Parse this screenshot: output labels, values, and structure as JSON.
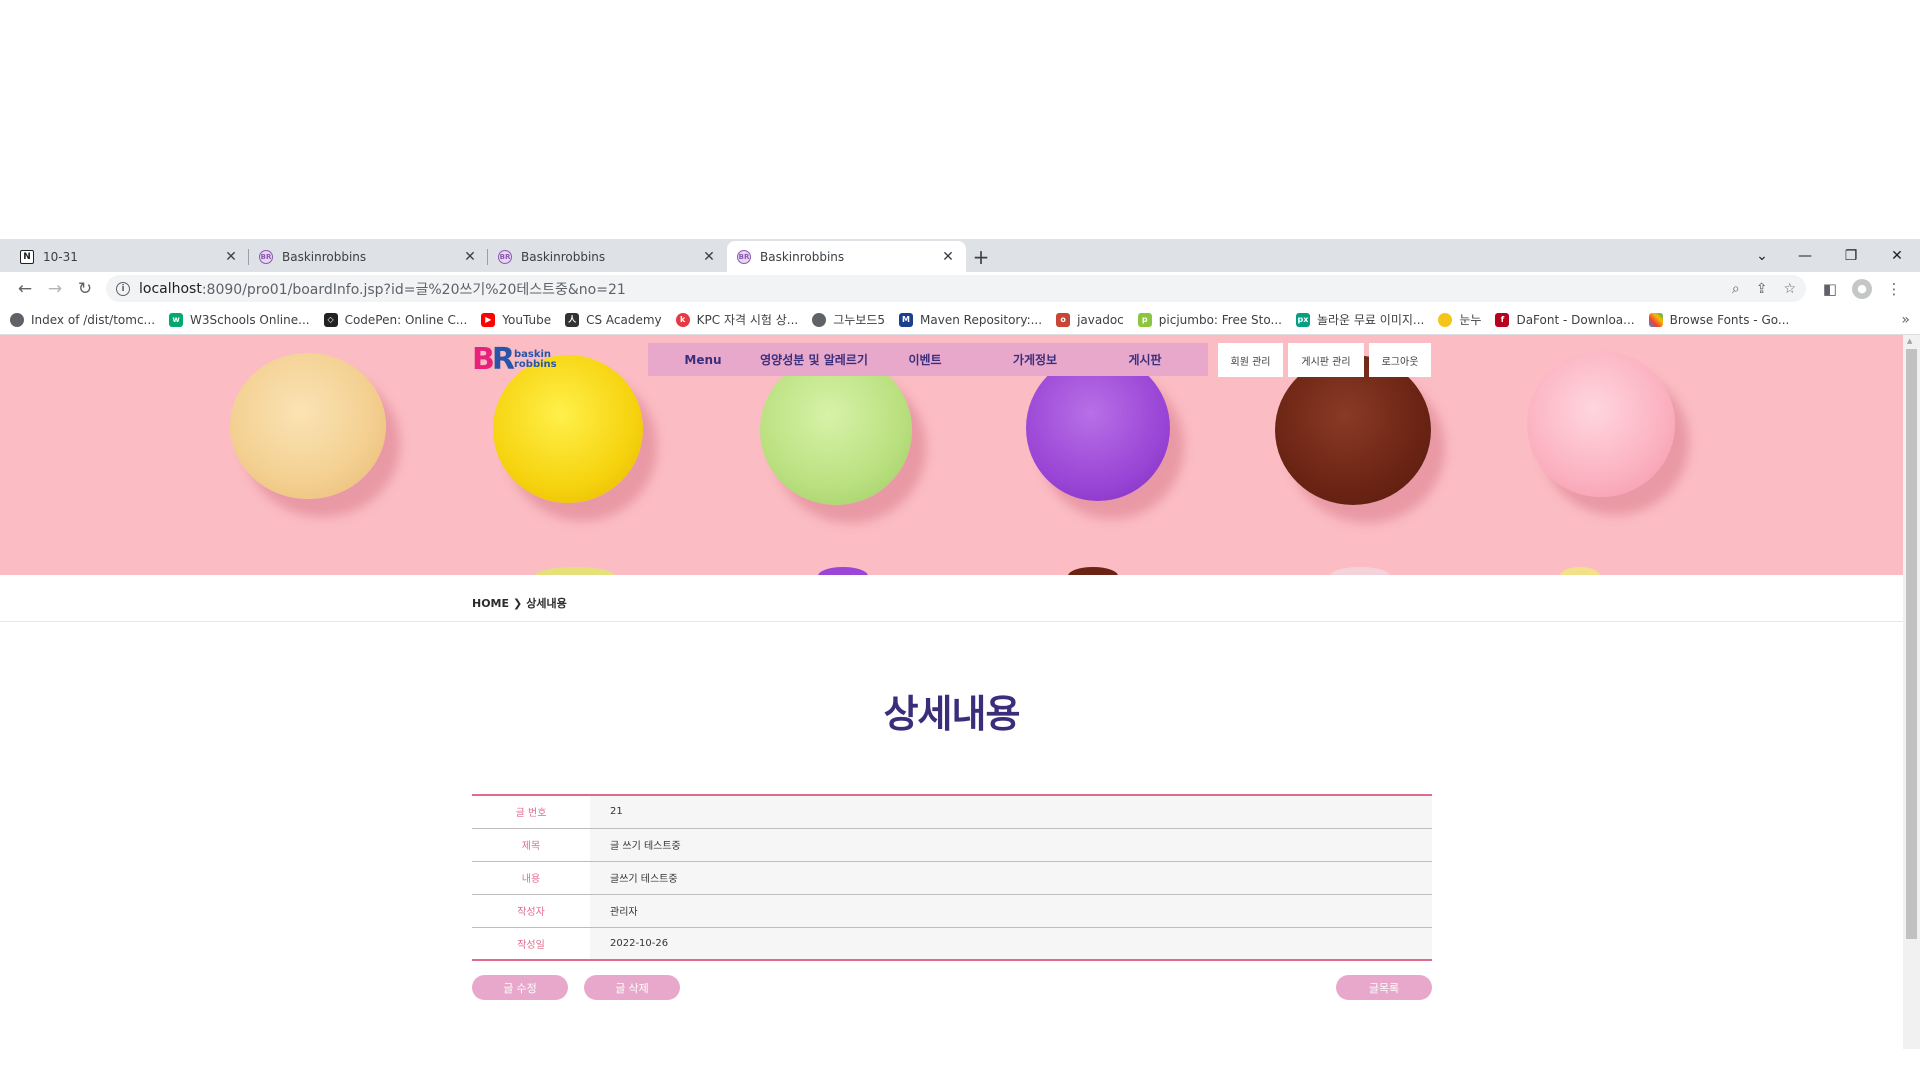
{
  "browser": {
    "tabs": [
      {
        "title": "10-31",
        "icon": "notion-icon"
      },
      {
        "title": "Baskinrobbins",
        "icon": "baskin-icon"
      },
      {
        "title": "Baskinrobbins",
        "icon": "baskin-icon"
      },
      {
        "title": "Baskinrobbins",
        "icon": "baskin-icon",
        "active": true
      }
    ],
    "url_host": "localhost",
    "url_rest": ":8090/pro01/boardInfo.jsp?id=글%20쓰기%20테스트중&no=21",
    "bookmarks": [
      "Index of /dist/tomc...",
      "W3Schools Online...",
      "CodePen: Online C...",
      "YouTube",
      "CS Academy",
      "KPC 자격 시험 상...",
      "그누보드5",
      "Maven Repository:...",
      "javadoc",
      "picjumbo: Free Sto...",
      "놀라운 무료 이미지...",
      "눈누",
      "DaFont - Downloa...",
      "Browse Fonts - Go..."
    ]
  },
  "site": {
    "logo_words": [
      "baskin",
      "robbins"
    ],
    "nav": [
      "Menu",
      "영양성분 및 알레르기",
      "이벤트",
      "가게정보",
      "게시판"
    ],
    "util": [
      "회원 관리",
      "게시판 관리",
      "로그아웃"
    ]
  },
  "breadcrumb": {
    "home": "HOME",
    "current": "상세내용"
  },
  "page_title": "상세내용",
  "detail": [
    {
      "label": "글 번호",
      "value": "21"
    },
    {
      "label": "제목",
      "value": "글 쓰기 테스트중"
    },
    {
      "label": "내용",
      "value": "글쓰기 테스트중"
    },
    {
      "label": "작성자",
      "value": "관리자"
    },
    {
      "label": "작성일",
      "value": "2022-10-26"
    }
  ],
  "buttons": {
    "edit": "글 수정",
    "delete": "글 삭제",
    "list": "글목록"
  },
  "colors": {
    "hero_bg": "#fbbcc3",
    "nav_bg": "#e7a8cb",
    "accent": "#e06c8c",
    "title": "#3b2d7a"
  }
}
